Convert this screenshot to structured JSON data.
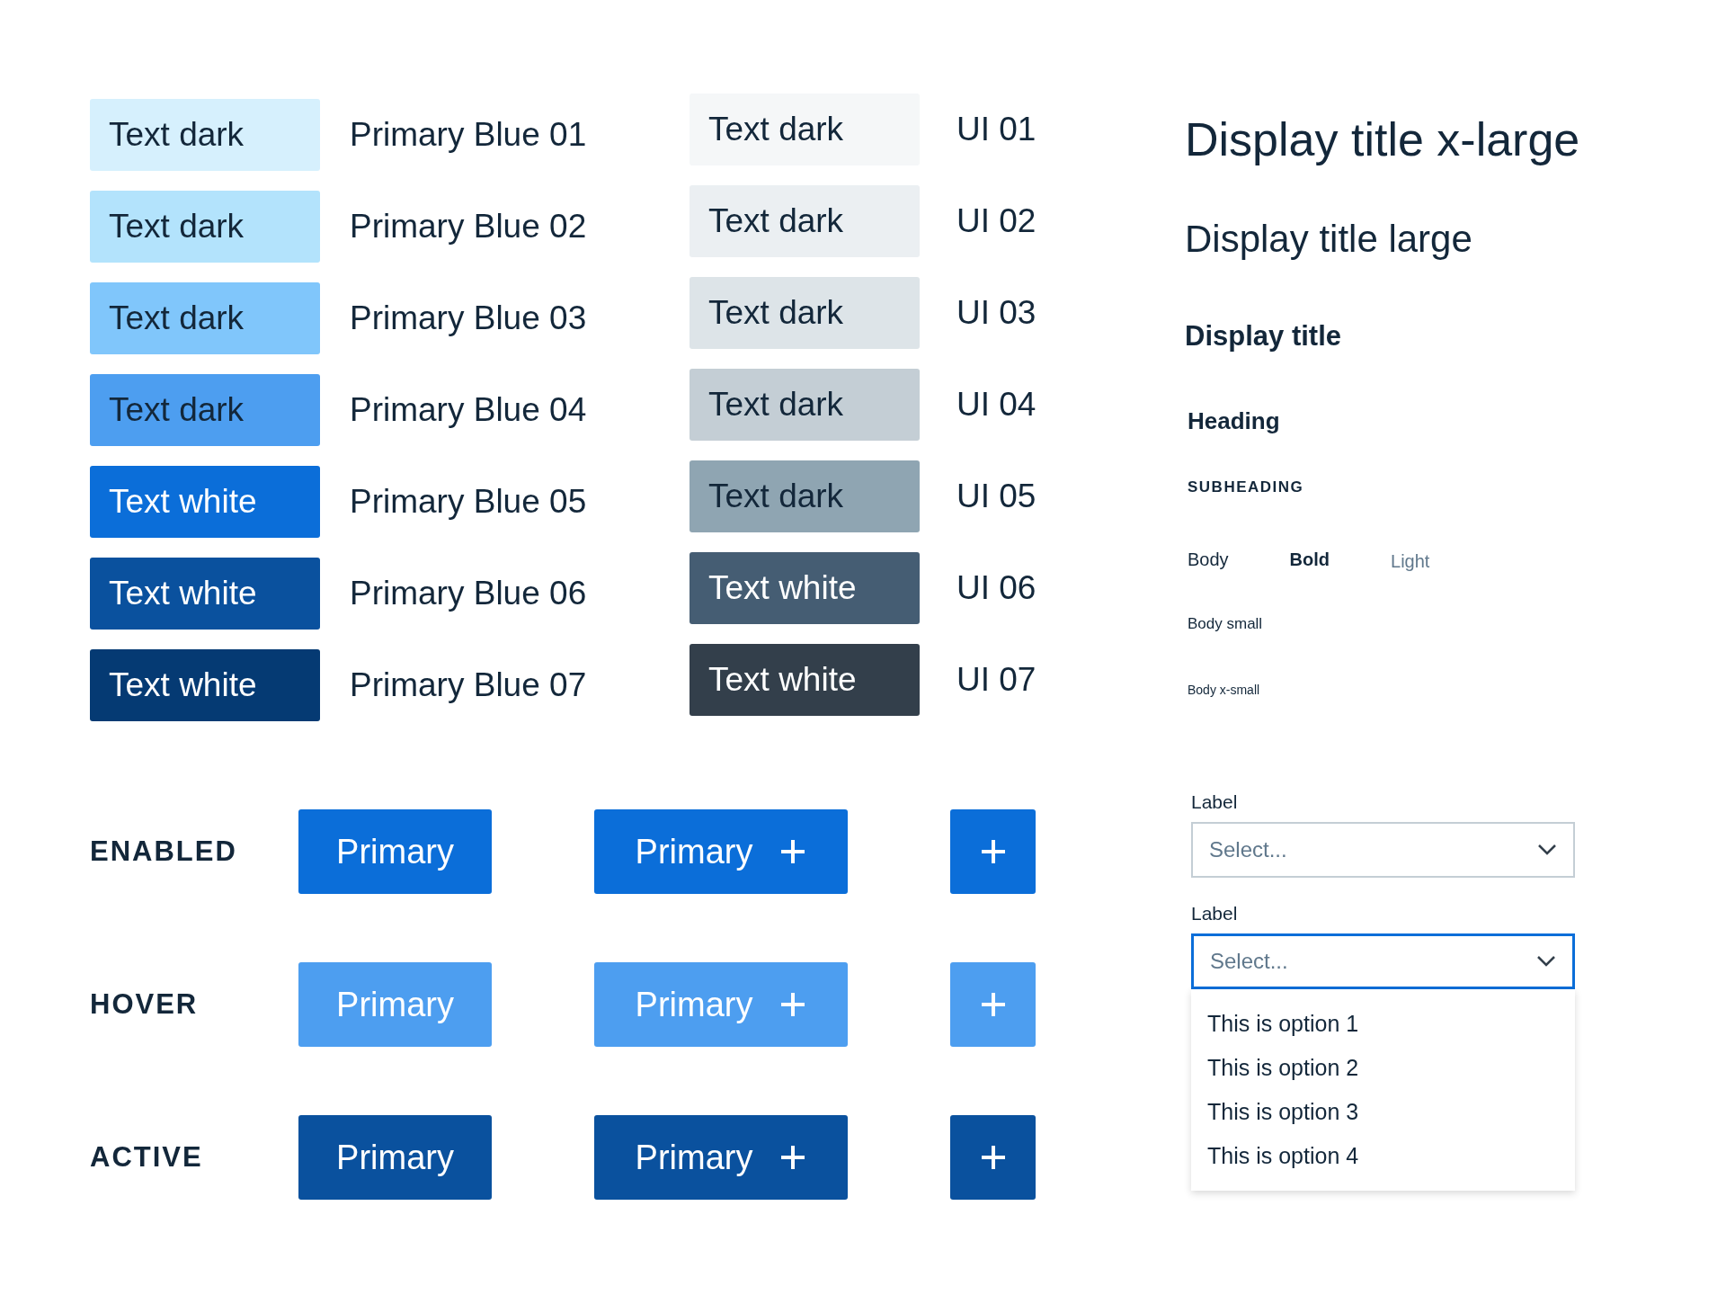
{
  "swatch_groups": [
    {
      "swatches": [
        {
          "sample": "Text dark",
          "name": "Primary Blue 01",
          "color": "#d6f0fd",
          "kind": "dark-text"
        },
        {
          "sample": "Text dark",
          "name": "Primary Blue 02",
          "color": "#b3e3fc",
          "kind": "dark-text"
        },
        {
          "sample": "Text dark",
          "name": "Primary Blue 03",
          "color": "#80c6fb",
          "kind": "dark-text"
        },
        {
          "sample": "Text dark",
          "name": "Primary Blue 04",
          "color": "#4d9ef0",
          "kind": "dark-text"
        },
        {
          "sample": "Text white",
          "name": "Primary Blue 05",
          "color": "#0b6ed9",
          "kind": "light-text"
        },
        {
          "sample": "Text white",
          "name": "Primary Blue 06",
          "color": "#0a519e",
          "kind": "light-text"
        },
        {
          "sample": "Text white",
          "name": "Primary Blue 07",
          "color": "#053a73",
          "kind": "light-text"
        }
      ]
    },
    {
      "swatches": [
        {
          "sample": "Text dark",
          "name": "UI 01",
          "color": "#f5f7f8",
          "kind": "dark-text"
        },
        {
          "sample": "Text dark",
          "name": "UI 02",
          "color": "#ebeff2",
          "kind": "dark-text"
        },
        {
          "sample": "Text dark",
          "name": "UI 03",
          "color": "#dde4e8",
          "kind": "dark-text"
        },
        {
          "sample": "Text dark",
          "name": "UI 04",
          "color": "#c4ced5",
          "kind": "dark-text"
        },
        {
          "sample": "Text dark",
          "name": "UI 05",
          "color": "#8fa5b2",
          "kind": "dark-text"
        },
        {
          "sample": "Text white",
          "name": "UI 06",
          "color": "#455d73",
          "kind": "light-text"
        },
        {
          "sample": "Text white",
          "name": "UI 07",
          "color": "#333f4b",
          "kind": "light-text"
        }
      ]
    }
  ],
  "typography": [
    {
      "kind": "display-xl",
      "text": "Display title x-large"
    },
    {
      "kind": "display-l",
      "text": "Display title large"
    },
    {
      "kind": "display",
      "text": "Display title"
    },
    {
      "kind": "heading",
      "text": "Heading"
    },
    {
      "kind": "subheading",
      "text": "SUBHEADING"
    },
    {
      "kind": "body-row",
      "variants": [
        {
          "kind": "regular",
          "text": "Body"
        },
        {
          "kind": "bold",
          "text": "Bold"
        },
        {
          "kind": "light",
          "text": "Light"
        }
      ]
    },
    {
      "kind": "body-small",
      "text": "Body small"
    },
    {
      "kind": "body-xsmall",
      "text": "Body x-small"
    }
  ],
  "button_states": [
    {
      "kind": "enabled",
      "label": "ENABLED",
      "buttons": [
        {
          "kind": "text",
          "label": "Primary"
        },
        {
          "kind": "text-icon",
          "label": "Primary"
        },
        {
          "kind": "icon"
        }
      ]
    },
    {
      "kind": "hover",
      "label": "HOVER",
      "buttons": [
        {
          "kind": "text",
          "label": "Primary"
        },
        {
          "kind": "text-icon",
          "label": "Primary"
        },
        {
          "kind": "icon"
        }
      ]
    },
    {
      "kind": "active",
      "label": "ACTIVE",
      "buttons": [
        {
          "kind": "text",
          "label": "Primary"
        },
        {
          "kind": "text-icon",
          "label": "Primary"
        },
        {
          "kind": "icon"
        }
      ]
    }
  ],
  "dropdowns": [
    {
      "label": "Label",
      "value": "Select...",
      "focused": false,
      "expanded": false
    },
    {
      "label": "Label",
      "value": "Select...",
      "focused": true,
      "expanded": true,
      "options": [
        "This is option 1",
        "This is option 2",
        "This is option 3",
        "This is option 4"
      ]
    }
  ]
}
